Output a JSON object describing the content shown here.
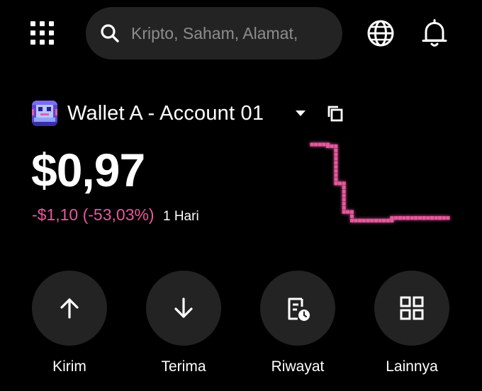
{
  "header": {
    "menu_icon": "grid-menu-icon",
    "search": {
      "placeholder": "Kripto, Saham, Alamat,",
      "value": "",
      "icon": "search-icon"
    },
    "language_icon": "globe-icon",
    "notifications_icon": "bell-icon"
  },
  "wallet": {
    "name": "Wallet A - Account 01",
    "avatar_icon": "pixel-avatar-icon",
    "dropdown_icon": "caret-down-icon",
    "copy_icon": "copy-icon"
  },
  "balance": {
    "amount": "$0,97",
    "change": "-$1,10 (-53,03%)",
    "period": "1 Hari"
  },
  "sparkline": {
    "color": "#e8589e",
    "values": [
      1.0,
      1.0,
      0.98,
      0.55,
      0.22,
      0.12,
      0.12,
      0.12,
      0.12,
      0.12,
      0.15,
      0.15,
      0.15,
      0.15,
      0.15,
      0.15,
      0.15,
      0.12
    ]
  },
  "actions": [
    {
      "label": "Kirim",
      "icon": "arrow-up-icon"
    },
    {
      "label": "Terima",
      "icon": "arrow-down-icon"
    },
    {
      "label": "Riwayat",
      "icon": "history-icon"
    },
    {
      "label": "Lainnya",
      "icon": "more-grid-icon"
    }
  ],
  "colors": {
    "background": "#000000",
    "surface": "#232323",
    "accent_negative": "#e8589e",
    "placeholder": "#8d8d8d"
  }
}
